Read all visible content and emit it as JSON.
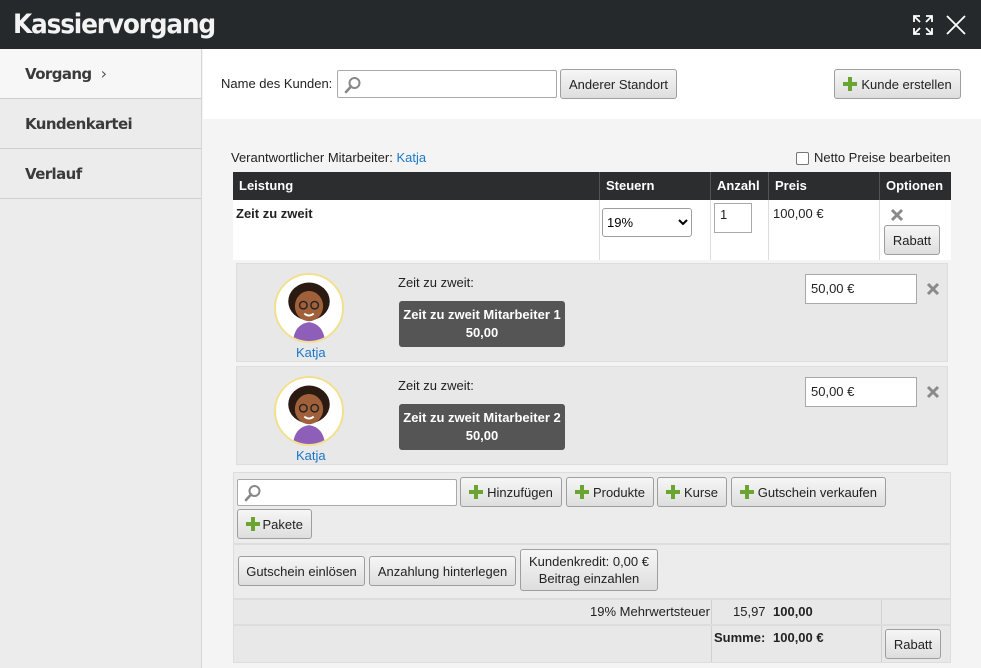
{
  "window": {
    "title": "Kassiervorgang"
  },
  "sidebar": {
    "items": [
      {
        "label": "Vorgang",
        "active": true
      },
      {
        "label": "Kundenkartei"
      },
      {
        "label": "Verlauf"
      }
    ]
  },
  "topbar": {
    "customer_label": "Name des Kunden:",
    "customer_value": "",
    "other_location": "Anderer Standort",
    "create_customer": "Kunde erstellen"
  },
  "responsible": {
    "label": "Verantwortlicher Mitarbeiter:",
    "name": "Katja"
  },
  "net_prices": {
    "label": "Netto Preise bearbeiten",
    "checked": false
  },
  "table": {
    "headers": [
      "Leistung",
      "Steuern",
      "Anzahl",
      "Preis",
      "Optionen"
    ],
    "row": {
      "service": "Zeit zu zweit",
      "tax": "19%",
      "quantity": "1",
      "price": "100,00 €",
      "discount_button": "Rabatt"
    }
  },
  "employees": [
    {
      "name": "Katja",
      "service_label": "Zeit zu zweit:",
      "button_line1": "Zeit zu zweit Mitarbeiter 1",
      "button_line2": "50,00",
      "price": "50,00 €"
    },
    {
      "name": "Katja",
      "service_label": "Zeit zu zweit:",
      "button_line1": "Zeit zu zweit Mitarbeiter 2",
      "button_line2": "50,00",
      "price": "50,00 €"
    }
  ],
  "add_bar": {
    "search_value": "",
    "buttons": [
      "Hinzufügen",
      "Produkte",
      "Kurse",
      "Gutschein verkaufen",
      "Pakete"
    ]
  },
  "payment_bar": {
    "redeem_voucher": "Gutschein einlösen",
    "deposit": "Anzahlung hinterlegen",
    "credit_line1": "Kundenkredit: 0,00 €",
    "credit_line2": "Beitrag einzahlen"
  },
  "summary": {
    "vat_label": "19% Mehrwertsteuer",
    "vat_amount": "15,97",
    "vat_total": "100,00",
    "sum_label": "Summe:",
    "sum_value": "100,00 €",
    "discount_button": "Rabatt"
  },
  "colors": {
    "titlebar": "#25292b",
    "link": "#1a77c9",
    "plus": "#6aa431",
    "header": "#2b2d2e"
  }
}
